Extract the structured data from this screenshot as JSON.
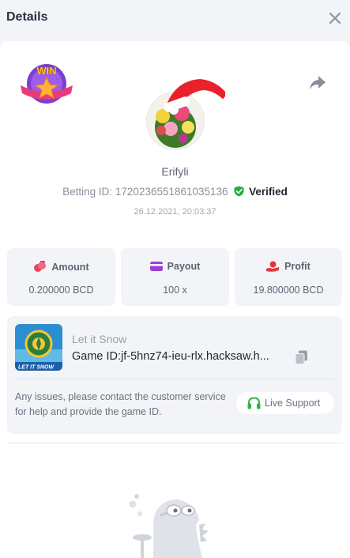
{
  "header": {
    "title": "Details",
    "close_icon": "close-icon"
  },
  "badge": {
    "text": "WIN",
    "icon": "win-star-badge"
  },
  "share_icon": "share-icon",
  "user": {
    "name": "Erifyli",
    "betting_id_label": "Betting ID: 1720236551861035136",
    "verified_label": "Verified",
    "datetime": "26.12.2021, 20:03:37"
  },
  "stats": [
    {
      "label": "Amount",
      "value": "0.200000 BCD",
      "icon": "coins-icon",
      "color": "#e8435f"
    },
    {
      "label": "Payout",
      "value": "100 x",
      "icon": "wallet-icon",
      "color": "#9b3fd6"
    },
    {
      "label": "Profit",
      "value": "19.800000 BCD",
      "icon": "profit-hand-icon",
      "color": "#e0393f"
    }
  ],
  "game": {
    "name": "Let it Snow",
    "id_text": "Game ID:jf-5hnz74-ieu-rlx.hacksaw.h...",
    "thumb_caption": "LET IT SNOW",
    "copy_icon": "copy-icon"
  },
  "support": {
    "message": "Any issues, please contact the customer service for help and provide the game ID.",
    "button_label": "Live Support",
    "icon": "headset-icon"
  },
  "colors": {
    "accent_green": "#2fb24a",
    "verified_green": "#1fb141"
  }
}
